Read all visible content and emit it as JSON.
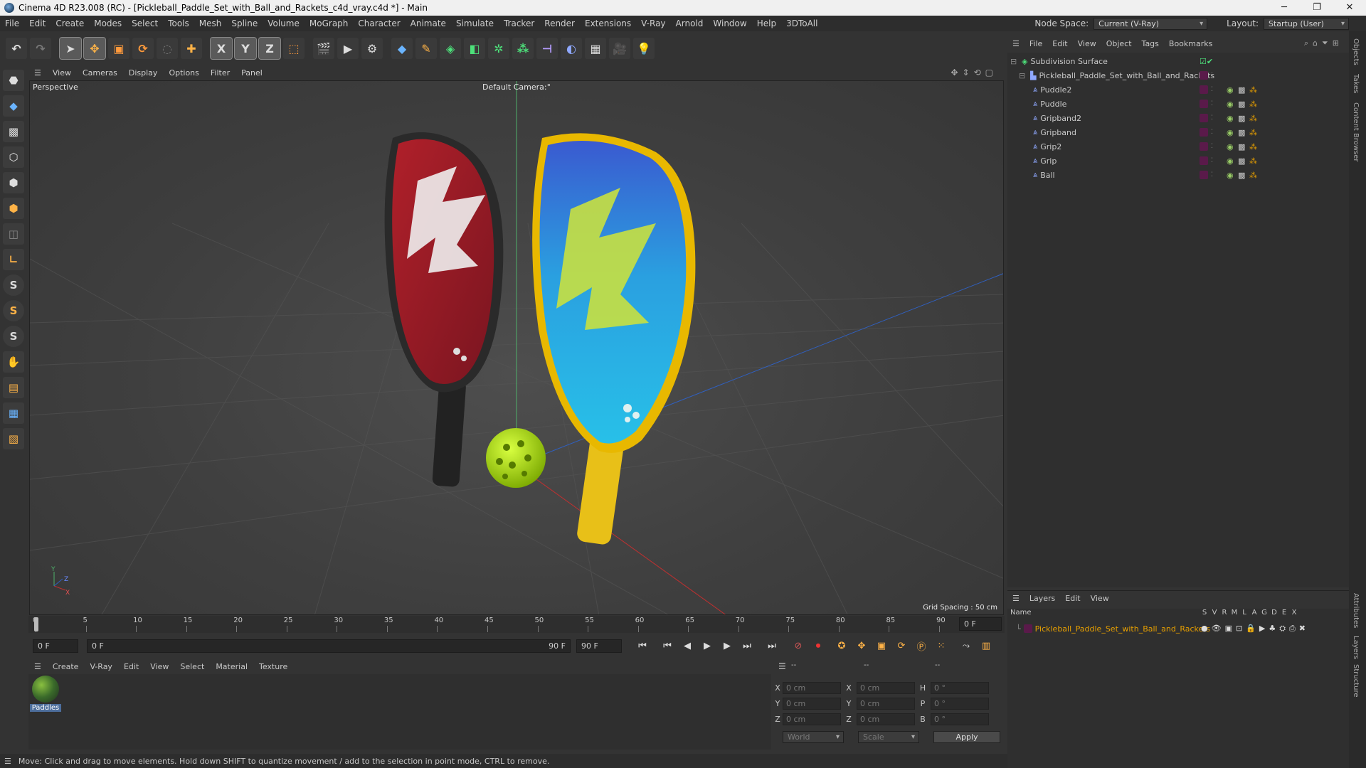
{
  "titlebar": {
    "title": "Cinema 4D R23.008 (RC) - [Pickleball_Paddle_Set_with_Ball_and_Rackets_c4d_vray.c4d *] - Main",
    "minimize": "─",
    "maximize": "❐",
    "close": "✕"
  },
  "menubar": {
    "items": [
      "File",
      "Edit",
      "Create",
      "Modes",
      "Select",
      "Tools",
      "Mesh",
      "Spline",
      "Volume",
      "MoGraph",
      "Character",
      "Animate",
      "Simulate",
      "Tracker",
      "Render",
      "Extensions",
      "V-Ray",
      "Arnold",
      "Window",
      "Help",
      "3DToAll"
    ],
    "node_space_label": "Node Space:",
    "node_space_value": "Current (V-Ray)",
    "layout_label": "Layout:",
    "layout_value": "Startup (User)"
  },
  "toolbar": {
    "axis_x": "X",
    "axis_y": "Y",
    "axis_z": "Z"
  },
  "lefttools": {
    "s1": "S",
    "s2": "S",
    "s3": "S"
  },
  "viewport": {
    "menu": [
      "View",
      "Cameras",
      "Display",
      "Options",
      "Filter",
      "Panel"
    ],
    "name": "Perspective",
    "camera": "Default Camera",
    "camera_suffix": ":°",
    "grid_spacing": "Grid Spacing : 50 cm",
    "axis_y": "Y",
    "axis_z": "Z",
    "axis_x": "X"
  },
  "timeline": {
    "ticks": [
      "0",
      "5",
      "10",
      "15",
      "20",
      "25",
      "30",
      "35",
      "40",
      "45",
      "50",
      "55",
      "60",
      "65",
      "70",
      "75",
      "80",
      "85",
      "90"
    ],
    "current_frame": "0 F"
  },
  "transport": {
    "start": "0 F",
    "range_start": "0 F",
    "range_end": "90 F",
    "end": "90 F"
  },
  "material_panel": {
    "menu": [
      "Create",
      "V-Ray",
      "Edit",
      "View",
      "Select",
      "Material",
      "Texture"
    ],
    "materials": [
      {
        "name": "Paddles"
      }
    ]
  },
  "coords": {
    "header": [
      "--",
      "--",
      "--"
    ],
    "pos_x_label": "X",
    "pos_y_label": "Y",
    "pos_z_label": "Z",
    "size_x_label": "X",
    "size_y_label": "Y",
    "size_z_label": "Z",
    "rot_h_label": "H",
    "rot_p_label": "P",
    "rot_b_label": "B",
    "pos_x": "0 cm",
    "pos_y": "0 cm",
    "pos_z": "0 cm",
    "size_x": "0 cm",
    "size_y": "0 cm",
    "size_z": "0 cm",
    "rot_h": "0 °",
    "rot_p": "0 °",
    "rot_b": "0 °",
    "coord_system": "World",
    "size_mode": "Scale",
    "apply": "Apply"
  },
  "status": {
    "text": "Move: Click and drag to move elements. Hold down SHIFT to quantize movement / add to the selection in point mode, CTRL to remove."
  },
  "object_manager": {
    "menu": [
      "File",
      "Edit",
      "View",
      "Object",
      "Tags",
      "Bookmarks"
    ],
    "objects": [
      {
        "name": "Subdivision Surface"
      },
      {
        "name": "Pickleball_Paddle_Set_with_Ball_and_Rackets"
      },
      {
        "name": "Puddle2"
      },
      {
        "name": "Puddle"
      },
      {
        "name": "Gripband2"
      },
      {
        "name": "Gripband"
      },
      {
        "name": "Grip2"
      },
      {
        "name": "Grip"
      },
      {
        "name": "Ball"
      }
    ]
  },
  "layers": {
    "menu": [
      "Layers",
      "Edit",
      "View"
    ],
    "columns": [
      "Name",
      "S",
      "V",
      "R",
      "M",
      "L",
      "A",
      "G",
      "D",
      "E",
      "X"
    ],
    "items": [
      {
        "name": "Pickleball_Paddle_Set_with_Ball_and_Rackets"
      }
    ]
  },
  "side_tabs": [
    "Objects",
    "Takes",
    "Content Browser",
    "Attributes",
    "Layers",
    "Structure"
  ],
  "colors": {
    "accent_orange": "#e8a000",
    "layer_color": "#5a1a4a",
    "selection_blue": "#4d6e9c"
  }
}
